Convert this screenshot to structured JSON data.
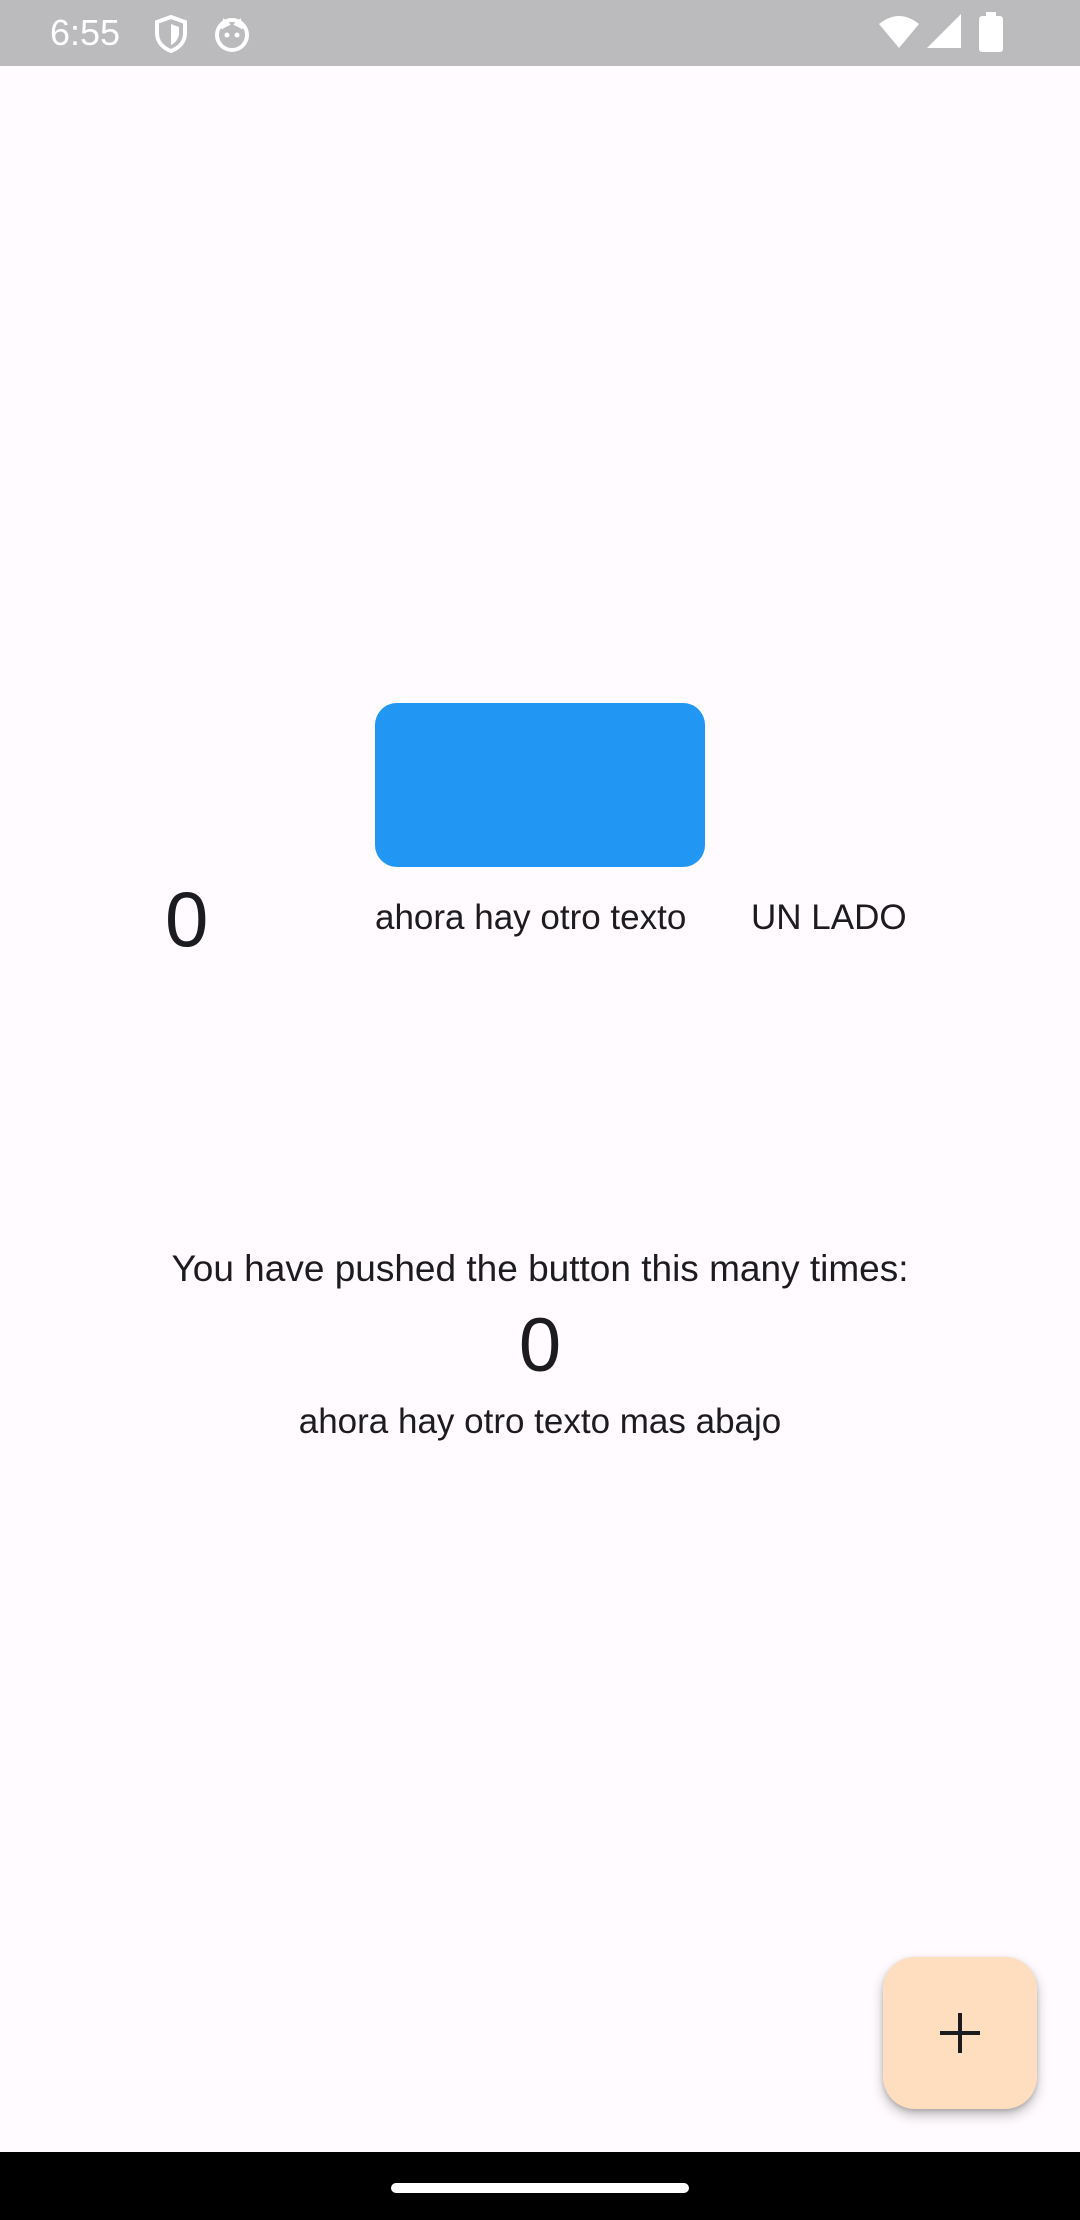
{
  "status_bar": {
    "time": "6:55",
    "icons": [
      "shield-icon",
      "cat-icon",
      "wifi-icon",
      "signal-icon",
      "battery-icon"
    ],
    "background": "#BBBABD"
  },
  "main": {
    "side_counter": "0",
    "side_text": "ahora hay otro texto",
    "side_text_2": "UN LADO",
    "pushed_label": "You have pushed the button this many times:",
    "counter": "0",
    "below_text": "ahora hay otro texto mas abajo",
    "box_color": "#2196F3"
  },
  "fab": {
    "icon": "plus-icon",
    "color": "#FFDDBF"
  },
  "nav_bar": {
    "background": "#000000"
  }
}
